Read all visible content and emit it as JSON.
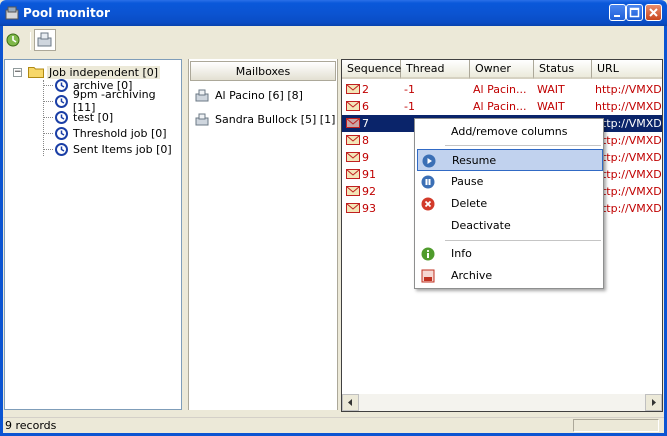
{
  "window": {
    "title": "Pool monitor"
  },
  "toolbar": {
    "buttons": [
      {
        "icon": "refresh-icon"
      },
      {
        "icon": "mailbox-icon"
      }
    ]
  },
  "tree": {
    "root": {
      "label": "Job independent [0]",
      "expander": "−"
    },
    "items": [
      {
        "label": "archive [0]"
      },
      {
        "label": "9pm -archiving [11]"
      },
      {
        "label": "test [0]"
      },
      {
        "label": "Threshold job [0]"
      },
      {
        "label": "Sent Items job [0]"
      }
    ]
  },
  "mailboxes": {
    "header": "Mailboxes",
    "items": [
      {
        "label": "Al Pacino [6] [8]"
      },
      {
        "label": "Sandra Bullock [5] [1]"
      }
    ]
  },
  "messages": {
    "columns": [
      "Sequence",
      "Thread",
      "Owner",
      "Status",
      "URL"
    ],
    "rows": [
      {
        "sequence": "2",
        "thread": "-1",
        "owner": "Al Pacin...",
        "status": "WAIT",
        "url": "http://VMXDE"
      },
      {
        "sequence": "6",
        "thread": "-1",
        "owner": "Al Pacin...",
        "status": "WAIT",
        "url": "http://VMXDE"
      },
      {
        "sequence": "7",
        "thread": "",
        "owner": "",
        "status": "",
        "url": "http://VMXDE",
        "selected": true
      },
      {
        "sequence": "8",
        "thread": "",
        "owner": "",
        "status": "",
        "url": "http://VMXDE"
      },
      {
        "sequence": "9",
        "thread": "",
        "owner": "",
        "status": "",
        "url": "http://VMXDE"
      },
      {
        "sequence": "91",
        "thread": "",
        "owner": "",
        "status": "",
        "url": "http://VMXDE"
      },
      {
        "sequence": "92",
        "thread": "",
        "owner": "",
        "status": "",
        "url": "http://VMXDE"
      },
      {
        "sequence": "93",
        "thread": "",
        "owner": "",
        "status": "",
        "url": "http://VMXDE"
      }
    ]
  },
  "context_menu": {
    "items": [
      {
        "label": "Add/remove columns",
        "icon": ""
      },
      {
        "label": "Resume",
        "icon": "play-icon",
        "highlighted": true
      },
      {
        "label": "Pause",
        "icon": "pause-icon"
      },
      {
        "label": "Delete",
        "icon": "delete-icon"
      },
      {
        "label": "Deactivate",
        "icon": ""
      },
      {
        "label": "Info",
        "icon": "info-icon"
      },
      {
        "label": "Archive",
        "icon": "archive-icon"
      }
    ]
  },
  "status": {
    "text": "9 records"
  },
  "colors": {
    "title_bar": "#0b54d2",
    "row_text": "#c00000",
    "selection": "#0a246a",
    "menu_highlight": "#c1d2ee"
  }
}
